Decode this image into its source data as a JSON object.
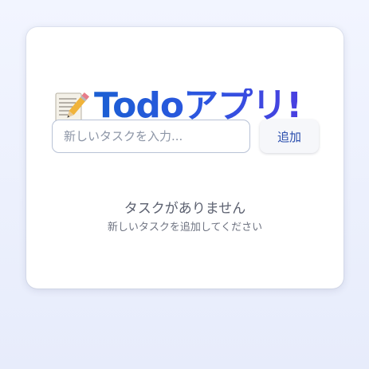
{
  "app": {
    "title_emoji_icon": "memo-pencil-icon",
    "title": "Todoアプリ!"
  },
  "form": {
    "placeholder": "新しいタスクを入力...",
    "value": "",
    "add_label": "追加"
  },
  "empty_state": {
    "title": "タスクがありません",
    "subtitle": "新しいタスクを追加してください"
  },
  "colors": {
    "title_gradient_start": "#1b5fd3",
    "title_gradient_end": "#4a3fe0",
    "button_text": "#2b4fae"
  }
}
